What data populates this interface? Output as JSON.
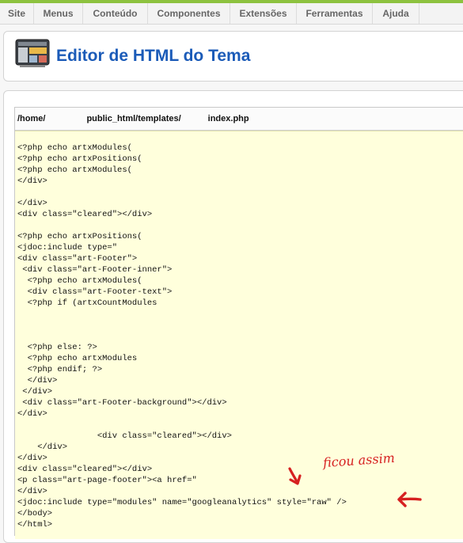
{
  "menu": {
    "items": [
      {
        "label": "Site",
        "name": "menu-site"
      },
      {
        "label": "Menus",
        "name": "menu-menus"
      },
      {
        "label": "Conteúdo",
        "name": "menu-conteudo"
      },
      {
        "label": "Componentes",
        "name": "menu-componentes"
      },
      {
        "label": "Extensões",
        "name": "menu-extensoes"
      },
      {
        "label": "Ferramentas",
        "name": "menu-ferramentas"
      },
      {
        "label": "Ajuda",
        "name": "menu-ajuda"
      }
    ]
  },
  "header": {
    "title": "Editor de HTML do Tema",
    "icon": "template-editor-icon"
  },
  "editor": {
    "path_parts": [
      "/home/",
      "public_html/templates/",
      "index.php"
    ],
    "code_lines": [
      "<?php echo artxModules(",
      "<?php echo artxPositions(",
      "<?php echo artxModules(",
      "</div>",
      "",
      "</div>",
      "<div class=\"cleared\"></div>",
      "",
      "<?php echo artxPositions(",
      "<jdoc:include type=\"",
      "<div class=\"art-Footer\">",
      " <div class=\"art-Footer-inner\">",
      "  <?php echo artxModules(",
      "  <div class=\"art-Footer-text\">",
      "  <?php if (artxCountModules",
      "",
      "",
      "",
      "  <?php else: ?>",
      "  <?php echo artxModules",
      "  <?php endif; ?>",
      "  </div>",
      " </div>",
      " <div class=\"art-Footer-background\"></div>",
      "</div>",
      "",
      "                <div class=\"cleared\"></div>",
      "    </div>",
      "</div>",
      "<div class=\"cleared\"></div>",
      "<p class=\"art-page-footer\"><a href=\"",
      "</div>",
      "<jdoc:include type=\"modules\" name=\"googleanalytics\" style=\"raw\" />",
      "</body>",
      "</html>"
    ]
  },
  "annotation": {
    "text": "ficou assim",
    "color": "#d62020"
  }
}
